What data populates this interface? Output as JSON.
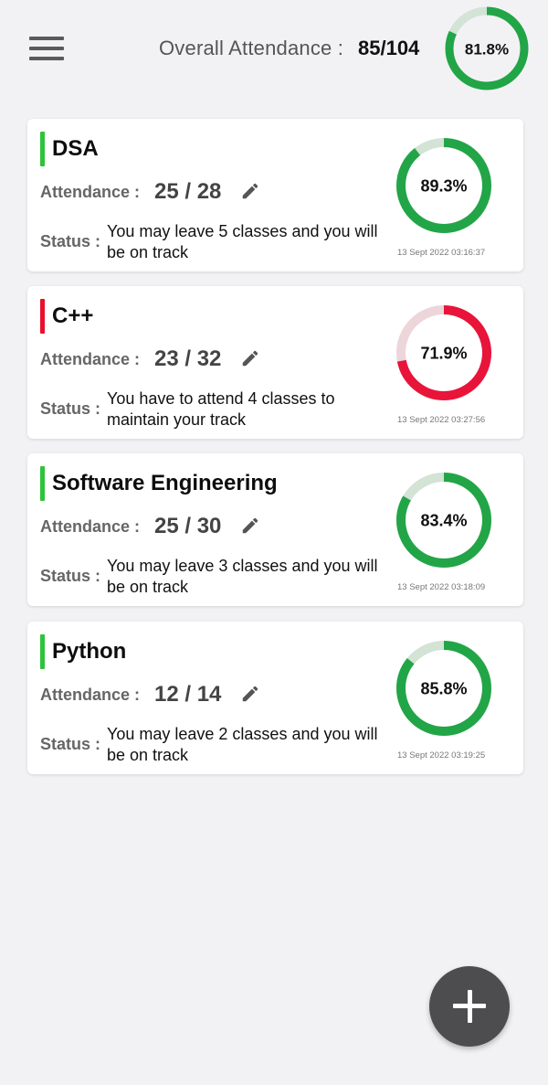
{
  "header": {
    "overall_label": "Overall Attendance :",
    "overall_value": "85/104",
    "overall_percent_label": "81.8%",
    "overall_fraction": 0.818,
    "ring_color": "#22a547",
    "ring_track_color": "#d3e3d6"
  },
  "subjects": [
    {
      "name": "DSA",
      "marker_color": "#2ec33a",
      "attendance_label": "Attendance :",
      "attendance_value": "25 / 28",
      "status_label": "Status :",
      "status_text": "You may leave 5 classes and you will be on track",
      "percent_label": "89.3%",
      "fraction": 0.893,
      "ring_color": "#22a547",
      "ring_track_color": "#d3e3d6",
      "timestamp": "13 Sept 2022 03:16:37"
    },
    {
      "name": "C++",
      "marker_color": "#e8102c",
      "attendance_label": "Attendance :",
      "attendance_value": "23 / 32",
      "status_label": "Status :",
      "status_text": "You have to attend 4 classes to maintain your track",
      "percent_label": "71.9%",
      "fraction": 0.719,
      "ring_color": "#e8143a",
      "ring_track_color": "#ecd6d9",
      "timestamp": "13 Sept 2022 03:27:56"
    },
    {
      "name": "Software Engineering",
      "marker_color": "#2ec33a",
      "attendance_label": "Attendance :",
      "attendance_value": "25 / 30",
      "status_label": "Status :",
      "status_text": "You may leave 3 classes and you will be on track",
      "percent_label": "83.4%",
      "fraction": 0.834,
      "ring_color": "#22a547",
      "ring_track_color": "#d3e3d6",
      "timestamp": "13 Sept 2022 03:18:09"
    },
    {
      "name": "Python",
      "marker_color": "#2ec33a",
      "attendance_label": "Attendance :",
      "attendance_value": "12 / 14",
      "status_label": "Status :",
      "status_text": "You may leave 2 classes and you will be on track",
      "percent_label": "85.8%",
      "fraction": 0.858,
      "ring_color": "#22a547",
      "ring_track_color": "#d3e3d6",
      "timestamp": "13 Sept 2022 03:19:25"
    }
  ],
  "icons": {
    "menu": "menu-icon",
    "edit": "pencil-icon",
    "add": "plus-icon"
  }
}
